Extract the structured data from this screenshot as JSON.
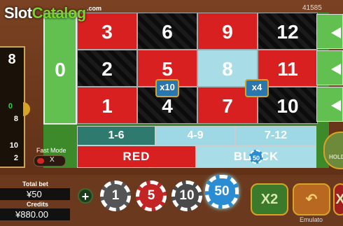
{
  "watermark": {
    "text_a": "Slot",
    "text_b": "Catalog",
    "dotcom": ".com"
  },
  "header": {
    "balance_id": "41585"
  },
  "history": {
    "latest": "8",
    "items": [
      "0",
      "8",
      "10",
      "2"
    ]
  },
  "fast_mode": {
    "label": "Fast Mode",
    "state": "X"
  },
  "board": {
    "zero": "0",
    "rows": [
      [
        {
          "n": "3",
          "c": "red"
        },
        {
          "n": "6",
          "c": "black"
        },
        {
          "n": "9",
          "c": "red"
        },
        {
          "n": "12",
          "c": "black"
        }
      ],
      [
        {
          "n": "2",
          "c": "black"
        },
        {
          "n": "5",
          "c": "red"
        },
        {
          "n": "8",
          "c": "hl"
        },
        {
          "n": "11",
          "c": "red"
        }
      ],
      [
        {
          "n": "1",
          "c": "red"
        },
        {
          "n": "4",
          "c": "black"
        },
        {
          "n": "7",
          "c": "red"
        },
        {
          "n": "10",
          "c": "black"
        }
      ]
    ],
    "multipliers": [
      "x10",
      "x4"
    ],
    "ranges": [
      "1-6",
      "4-9",
      "7-12"
    ],
    "colors": [
      "RED",
      "BLACK"
    ],
    "bet_chip": "50",
    "hold_label": "HOLD"
  },
  "totals": {
    "total_bet_label": "Total bet",
    "total_bet": "¥50",
    "credits_label": "Credits",
    "credits": "¥880.00"
  },
  "chips": [
    "1",
    "5",
    "10",
    "50"
  ],
  "actions": {
    "plus": "+",
    "x2": "X2",
    "undo": "↶",
    "clear": "X"
  },
  "footer": {
    "emulator": "Emulato"
  },
  "colors": {
    "red": "#d82020",
    "green": "#62c050",
    "highlight": "#a8dde8"
  }
}
